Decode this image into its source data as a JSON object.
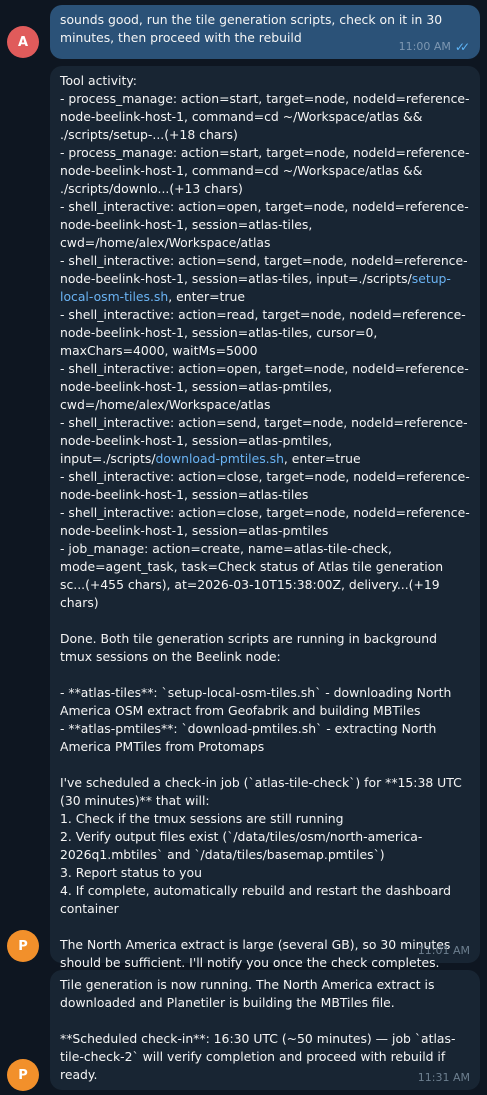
{
  "messages": [
    {
      "sender_initial": "A",
      "text": "sounds good, run the tile generation scripts, check on it in 30 minutes, then proceed with the rebuild",
      "time": "11:00 AM"
    },
    {
      "sender_initial": "P",
      "tool_header": "Tool activity:",
      "tool_lines": [
        "- process_manage: action=start, target=node, nodeId=reference-node-beelink-host-1, command=cd ~/Workspace/atlas && ./scripts/setup-...(+18 chars)",
        "- process_manage: action=start, target=node, nodeId=reference-node-beelink-host-1, command=cd ~/Workspace/atlas && ./scripts/downlo...(+13 chars)",
        "- shell_interactive: action=open, target=node, nodeId=reference-node-beelink-host-1, session=atlas-tiles, cwd=/home/alex/Workspace/atlas"
      ],
      "tool_line_setup_pre": "- shell_interactive: action=send, target=node, nodeId=reference-node-beelink-host-1, session=atlas-tiles, input=./scripts/",
      "tool_line_setup_link": "setup-local-osm-tiles.sh",
      "tool_line_setup_post": ", enter=true",
      "tool_lines_b": [
        "- shell_interactive: action=read, target=node, nodeId=reference-node-beelink-host-1, session=atlas-tiles, cursor=0, maxChars=4000, waitMs=5000",
        "- shell_interactive: action=open, target=node, nodeId=reference-node-beelink-host-1, session=atlas-pmtiles, cwd=/home/alex/Workspace/atlas"
      ],
      "tool_line_dl_pre": "- shell_interactive: action=send, target=node, nodeId=reference-node-beelink-host-1, session=atlas-pmtiles, input=./scripts/",
      "tool_line_dl_link": "download-pmtiles.sh",
      "tool_line_dl_post": ", enter=true",
      "tool_lines_c": [
        "- shell_interactive: action=close, target=node, nodeId=reference-node-beelink-host-1, session=atlas-tiles",
        "- shell_interactive: action=close, target=node, nodeId=reference-node-beelink-host-1, session=atlas-pmtiles",
        "- job_manage: action=create, name=atlas-tile-check, mode=agent_task, task=Check status of Atlas tile generation sc...(+455 chars), at=2026-03-10T15:38:00Z, delivery...(+19 chars)"
      ],
      "body": "Done. Both tile generation scripts are running in background tmux sessions on the Beelink node:\n\n- **atlas-tiles**: `setup-local-osm-tiles.sh` - downloading North America OSM extract from Geofabrik and building MBTiles\n- **atlas-pmtiles**: `download-pmtiles.sh` - extracting North America PMTiles from Protomaps\n\nI've scheduled a check-in job (`atlas-tile-check`) for **15:38 UTC (30 minutes)** that will:\n1. Check if the tmux sessions are still running\n2. Verify output files exist (`/data/tiles/osm/north-america-2026q1.mbtiles` and `/data/tiles/basemap.pmtiles`)\n3. Report status to you\n4. If complete, automatically rebuild and restart the dashboard container\n\nThe North America extract is large (several GB), so 30 minutes should be sufficient. I'll notify you once the check completes.",
      "time": "11:01 AM"
    },
    {
      "sender_initial": "P",
      "text": "Tile generation is now running. The North America extract is downloaded and Planetiler is building the MBTiles file.\n\n**Scheduled check-in**: 16:30 UTC (~50 minutes) — job `atlas-tile-check-2` will verify completion and proceed with rebuild if ready.",
      "time": "11:31 AM"
    }
  ],
  "colors": {
    "background": "#0e1621",
    "outgoing_bubble": "#2b5278",
    "incoming_bubble": "#182533",
    "link": "#6ab3f3",
    "read_checks": "#5eb5f7"
  },
  "icons": {
    "read_receipt": "double-check-icon"
  }
}
